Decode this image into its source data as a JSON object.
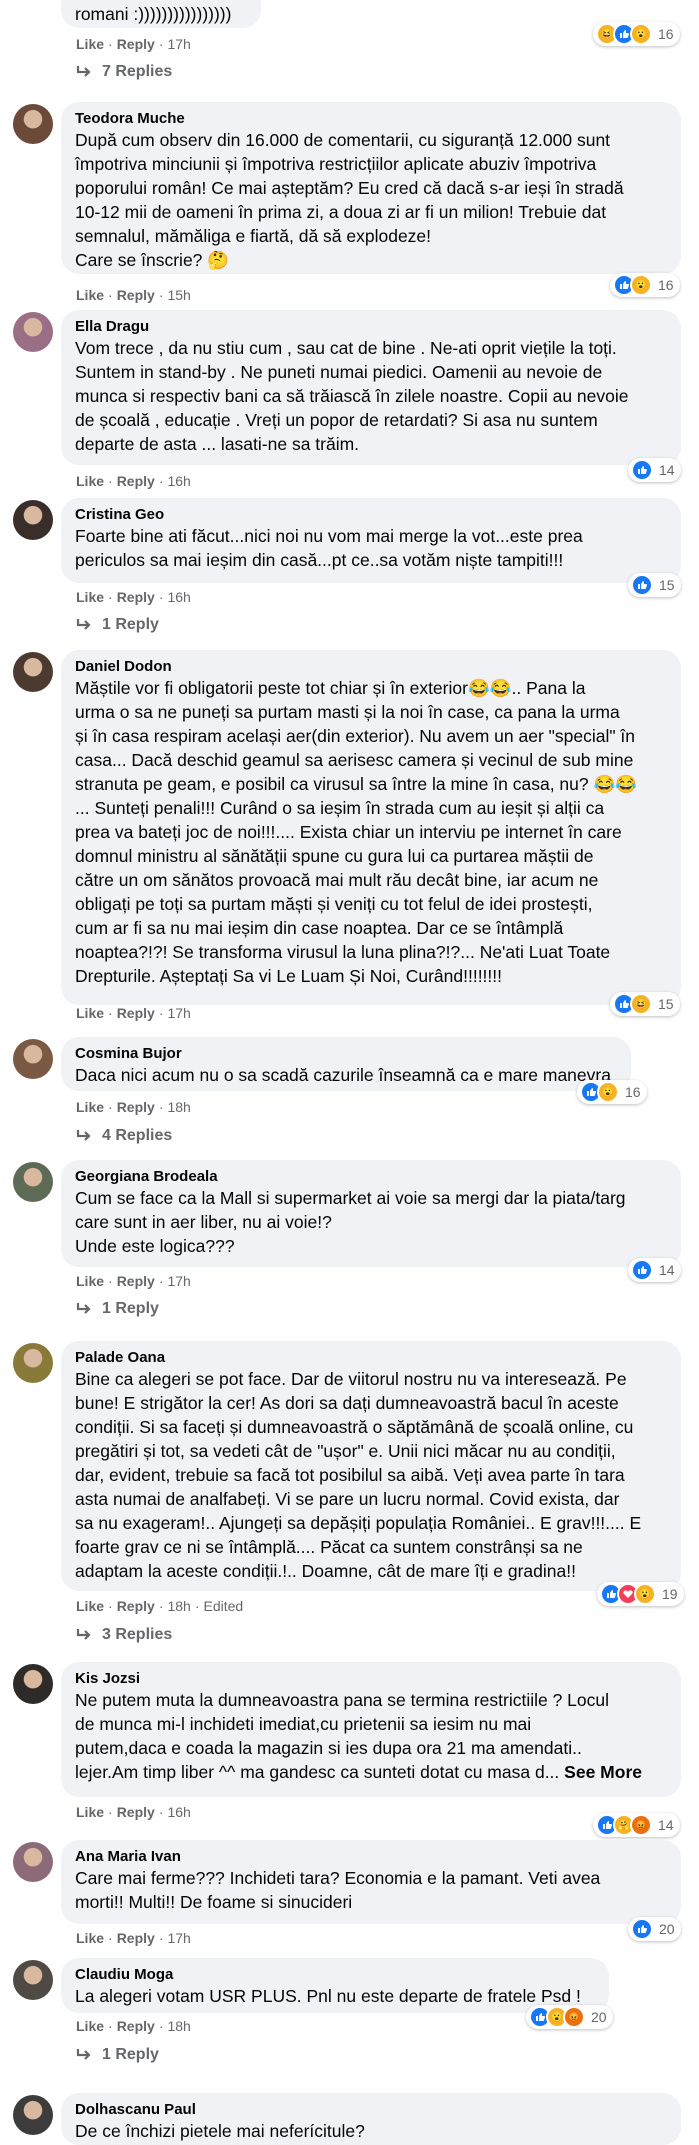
{
  "actions": {
    "like": "Like",
    "reply": "Reply",
    "sep": "·"
  },
  "top": {
    "text_tail": "romani :))))))))))))))))",
    "time": "17h",
    "reactions": [
      "haha",
      "like",
      "wow"
    ],
    "reaction_count": "16",
    "replies": "7 Replies"
  },
  "comments": [
    {
      "author": "Teodora Muche",
      "text": "După cum observ din 16.000 de comentarii, cu siguranță 12.000 sunt\nîmpotriva minciunii și împotriva restricțiilor aplicate abuziv împotriva\npoporului român! Ce mai așteptăm? Eu cred că dacă s-ar ieși în stradă\n10-12 mii de oameni în prima zi, a doua zi ar fi un milion! Trebuie dat\nsemnalul, mămăliga e fiartă, dă să explodeze!\nCare se înscrie? 🤔",
      "time": "15h",
      "reactions": [
        "like",
        "wow"
      ],
      "reaction_count": "16",
      "avatar_color": "#6b4a3a"
    },
    {
      "author": "Ella Dragu",
      "text": "Vom trece , da nu stiu cum , sau cat de bine . Ne-ati oprit viețile la toți.\nSuntem in stand-by . Ne puneti numai piedici. Oamenii au nevoie de\nmunca si respectiv bani ca să trăiască în zilele noastre. Copii au nevoie\nde școală , educație . Vreți un popor de retardati? Si asa nu suntem\ndeparte de asta ... lasati-ne sa trăim.",
      "time": "16h",
      "reactions": [
        "like"
      ],
      "reaction_count": "14",
      "avatar_color": "#9a6f86"
    },
    {
      "author": "Cristina Geo",
      "text": "Foarte bine ati făcut...nici noi nu vom mai merge la vot...este prea\npericulos sa mai ieșim din casă...pt ce..sa votăm niște tampiti!!!",
      "time": "16h",
      "reactions": [
        "like"
      ],
      "reaction_count": "15",
      "replies": "1 Reply",
      "avatar_color": "#3a2e2a"
    },
    {
      "author": "Daniel Dodon",
      "text": "Măștile vor fi obligatorii peste tot chiar și în exterior😂😂.. Pana la\nurma o sa ne puneți sa purtam masti și la noi în case, ca pana la urma\nși în casa respiram același aer(din exterior). Nu avem un aer \"special\" în\ncasa... Dacă deschid geamul sa aerisesc camera și vecinul de sub mine\nstranuta pe geam, e posibil ca virusul sa între la mine în casa, nu? 😂😂\n... Sunteți penali!!! Curând o sa ieșim în strada cum au ieșit și alții ca\nprea va bateți joc de noi!!!.... Exista chiar un interviu pe internet în care\ndomnul ministru al sănătății spune cu gura lui ca purtarea măștii de\ncătre un om sănătos provoacă mai mult rău decât bine, iar acum ne\nobligați pe toți sa purtam măști și veniți cu tot felul de idei prostești,\ncum ar fi sa nu mai ieșim din case noaptea. Dar ce se întâmplă\nnoaptea?!?! Se transforma virusul la luna plina?!?... Ne'ati Luat Toate\nDrepturile. Așteptați Sa vi Le Luam Și Noi, Curând!!!!!!!!",
      "time": "17h",
      "reactions": [
        "like",
        "haha"
      ],
      "reaction_count": "15",
      "avatar_color": "#4a3a30"
    },
    {
      "author": "Cosmina Bujor",
      "text": "Daca nici acum nu o sa scadă cazurile înseamnă ca e mare manevra",
      "time": "18h",
      "reactions": [
        "like",
        "wow"
      ],
      "reaction_count": "16",
      "replies": "4 Replies",
      "avatar_color": "#7a5a45"
    },
    {
      "author": "Georgiana Brodeala",
      "text": "Cum se face ca la Mall si supermarket ai voie sa mergi dar la piata/targ\ncare sunt in aer liber, nu ai voie!?\nUnde este logica???",
      "time": "17h",
      "reactions": [
        "like"
      ],
      "reaction_count": "14",
      "replies": "1 Reply",
      "avatar_color": "#5d6a55"
    },
    {
      "author": "Palade Oana",
      "text": "Bine ca alegeri se pot face. Dar de viitorul nostru nu va interesează. Pe\nbune! E strigător la cer! As dori sa dați dumneavoastră bacul în aceste\ncondiții. Si sa faceți și dumneavoastră o săptămână de școală online, cu\npregătiri și tot, sa vedeti cât de \"ușor\" e. Unii nici măcar nu au condiții,\ndar, evident, trebuie sa facă tot posibilul sa aibă. Veți avea parte în tara\nasta numai de analfabeți. Vi se pare un lucru normal. Covid exista, dar\nsa nu exageram!.. Ajungeți sa depășiți populația României.. E grav!!!.... E\nfoarte grav ce ni se întâmplă.... Păcat ca suntem constrânși sa ne\nadaptam la aceste condiții.!.. Doamne, cât de mare îți e gradina!!",
      "time": "18h",
      "edited": "Edited",
      "reactions": [
        "like",
        "love",
        "wow"
      ],
      "reaction_count": "19",
      "replies": "3 Replies",
      "avatar_color": "#8a7a3a"
    },
    {
      "author": "Kis Jozsi",
      "text": "Ne putem muta la dumneavoastra pana se termina restrictiile ? Locul\nde munca mi-l inchideti imediat,cu prietenii sa iesim nu mai\nputem,daca e coada la magazin si ies dupa ora 21 ma amendati..\nlejer.Am timp liber ^^ ma gandesc ca sunteti dotat cu masa d...",
      "see_more": "See More",
      "time": "16h",
      "reactions": [
        "like",
        "care",
        "angry"
      ],
      "reaction_count": "14",
      "avatar_color": "#2e2a28"
    },
    {
      "author": "Ana Maria Ivan",
      "text": "Care mai ferme??? Inchideti tara? Economia e la pamant. Veti avea\nmorti!! Multi!! De foame si sinucideri",
      "time": "17h",
      "reactions": [
        "like"
      ],
      "reaction_count": "20",
      "avatar_color": "#8c6a7a"
    },
    {
      "author": "Claudiu Moga",
      "text": "La alegeri votam USR PLUS. Pnl nu este departe de fratele Psd !",
      "time": "18h",
      "reactions": [
        "like",
        "wow",
        "angry"
      ],
      "reaction_count": "20",
      "replies": "1 Reply",
      "avatar_color": "#4f4a44"
    },
    {
      "author": "Dolhascanu Paul",
      "text": "De ce închizi pietele mai neferícitule?",
      "avatar_color": "#3c3c3c"
    }
  ]
}
